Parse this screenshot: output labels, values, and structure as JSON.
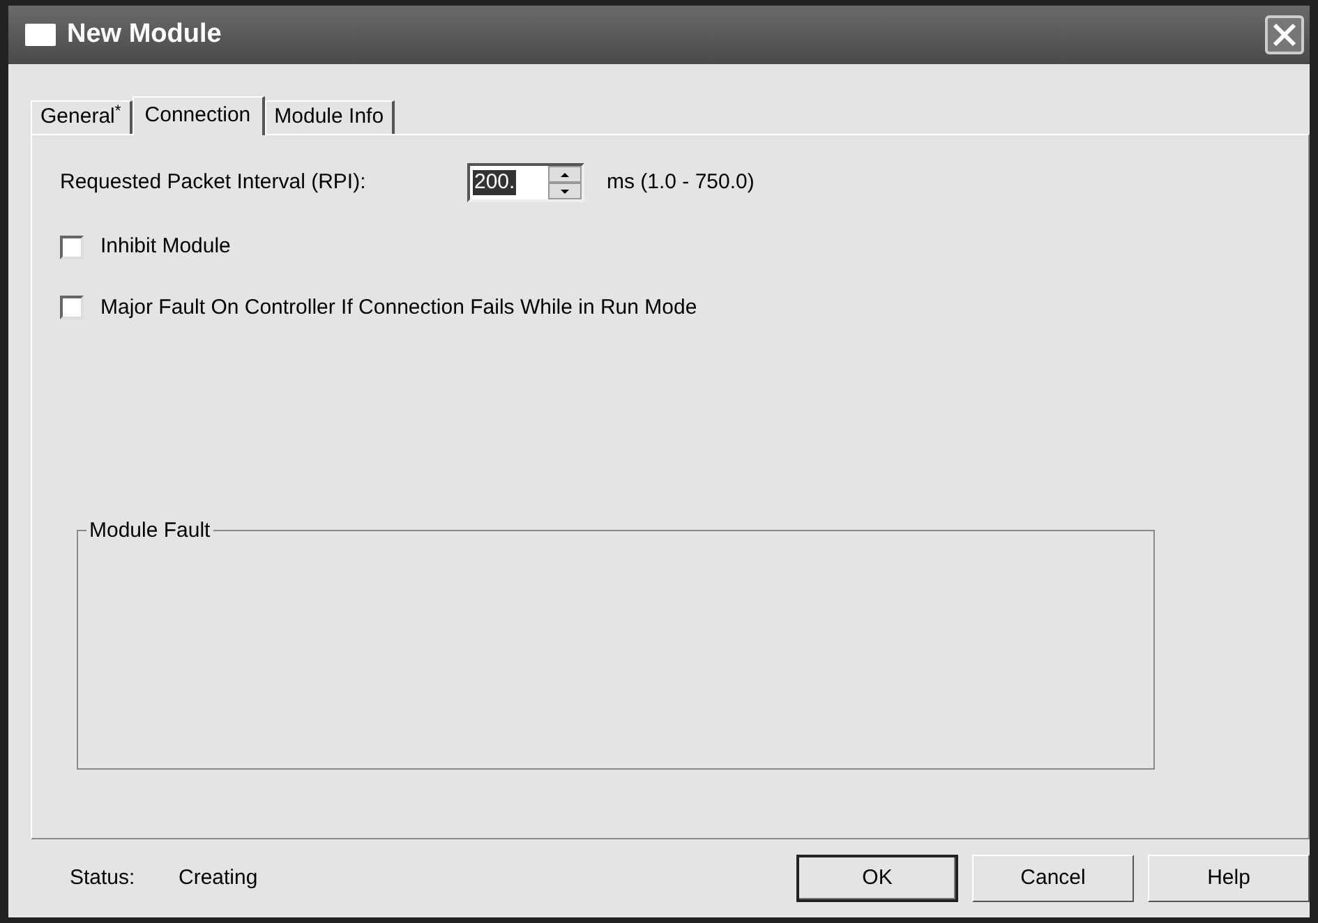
{
  "window": {
    "title": "New Module"
  },
  "tabs": [
    {
      "label": "General$^{*}$",
      "selected": false
    },
    {
      "label": "Connection",
      "selected": true
    },
    {
      "label": "Module Info",
      "selected": false
    }
  ],
  "rpi": {
    "label": "Requested Packet Interval (RPI):",
    "value": "200.",
    "range": "ms (1.0 - 750.0)"
  },
  "options": [
    {
      "label": "Inhibit Module",
      "checked": false
    },
    {
      "label": "Major Fault On Controller If Connection Fails While in Run Mode",
      "checked": false
    }
  ],
  "module_fault": {
    "title": "Module Fault"
  },
  "status": {
    "label": "Status:",
    "value": "Creating"
  },
  "buttons": [
    {
      "label": "OK",
      "default": true
    },
    {
      "label": "Cancel",
      "default": false
    },
    {
      "label": "Help",
      "default": false
    }
  ]
}
